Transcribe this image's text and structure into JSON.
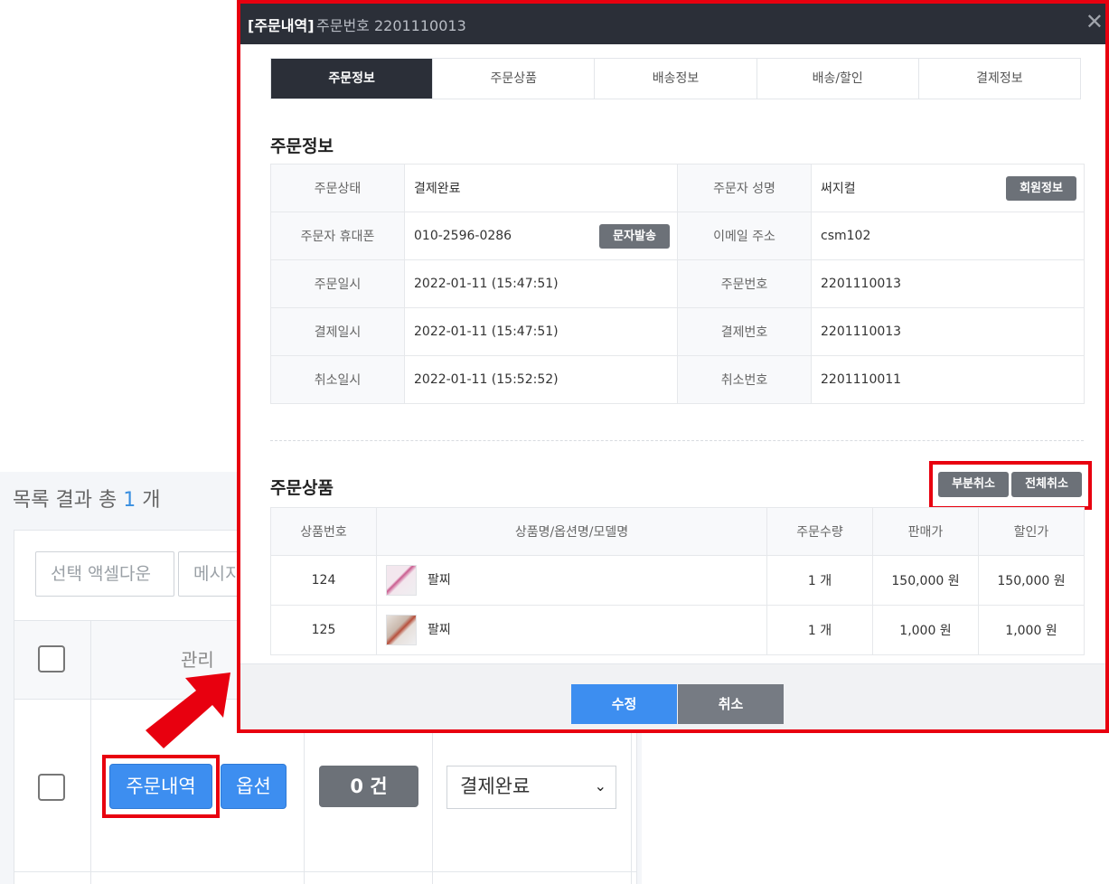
{
  "list": {
    "result_prefix": "목록 결과 총",
    "result_count": "1",
    "result_suffix": "개",
    "toolbar": {
      "excel_download_label": "선택 액셀다운",
      "message_label": "메시지"
    },
    "header": {
      "manage_label": "관리"
    },
    "row": {
      "order_detail_label": "주문내역",
      "option_label": "옵션",
      "count_label": "0 건",
      "status_value": "결제완료"
    }
  },
  "modal": {
    "title_bracket": "[주문내역]",
    "title_order_no": "주문번호 2201110013",
    "close_symbol": "✕",
    "tabs": [
      {
        "label": "주문정보",
        "active": true
      },
      {
        "label": "주문상품",
        "active": false
      },
      {
        "label": "배송정보",
        "active": false
      },
      {
        "label": "배송/할인",
        "active": false
      },
      {
        "label": "결제정보",
        "active": false
      }
    ],
    "order_info": {
      "title": "주문정보",
      "rows": [
        {
          "l1": "주문상태",
          "v1": "결제완료",
          "l2": "주문자 성명",
          "v2": "써지컬"
        },
        {
          "l1": "주문자 휴대폰",
          "v1": "010-2596-0286",
          "l2": "이메일 주소",
          "v2": "csm102"
        },
        {
          "l1": "주문일시",
          "v1": "2022-01-11 (15:47:51)",
          "l2": "주문번호",
          "v2": "2201110013"
        },
        {
          "l1": "결제일시",
          "v1": "2022-01-11 (15:47:51)",
          "l2": "결제번호",
          "v2": "2201110013"
        },
        {
          "l1": "취소일시",
          "v1": "2022-01-11 (15:52:52)",
          "l2": "취소번호",
          "v2": "2201110011"
        }
      ],
      "member_info_label": "회원정보",
      "sms_send_label": "문자발송"
    },
    "order_products": {
      "title": "주문상품",
      "partial_cancel_label": "부분취소",
      "full_cancel_label": "전체취소",
      "columns": [
        "상품번호",
        "상품명/옵션명/모델명",
        "주문수량",
        "판매가",
        "할인가"
      ],
      "items": [
        {
          "no": "124",
          "name": "팔찌",
          "qty": "1 개",
          "price": "150,000 원",
          "sale": "150,000 원"
        },
        {
          "no": "125",
          "name": "팔찌",
          "qty": "1 개",
          "price": "1,000 원",
          "sale": "1,000 원"
        }
      ]
    },
    "footer": {
      "save_label": "수정",
      "cancel_label": "취소"
    }
  },
  "colors": {
    "accent_blue": "#3d8ef0",
    "highlight_red": "#e8000f",
    "header_dark": "#2b2f38"
  }
}
